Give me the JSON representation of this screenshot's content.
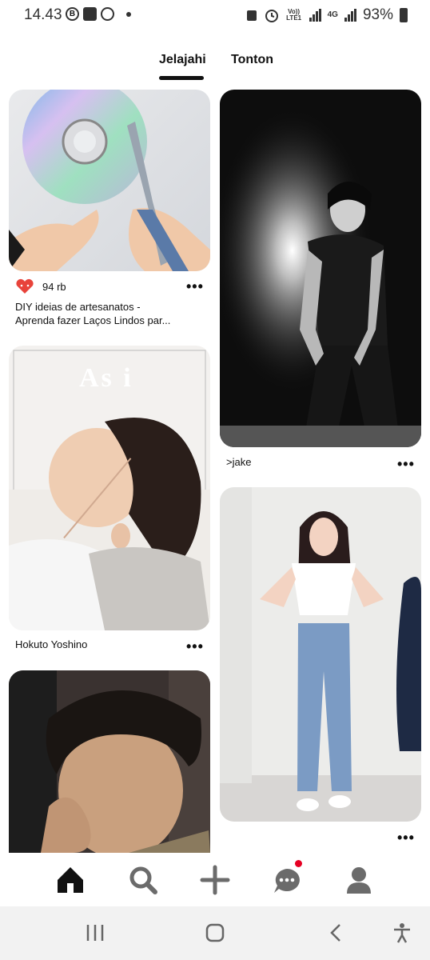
{
  "status_bar": {
    "time": "14.43",
    "network_label": "Vo)) LTE1",
    "network_type": "4G",
    "battery_percent": "93%"
  },
  "tabs": [
    {
      "label": "Jelajahi",
      "active": true
    },
    {
      "label": "Tonton",
      "active": false
    }
  ],
  "pins": {
    "diy": {
      "likes": "94 rb",
      "title_line1": "DIY ideias de artesanatos  -",
      "title_line2": "Aprenda fazer Laços Lindos par..."
    },
    "jake": {
      "title": ">jake"
    },
    "hokuto": {
      "title": "Hokuto Yoshino",
      "image_text": "As i"
    }
  },
  "more_label": "•••",
  "bottom_nav": {
    "items": [
      "home-icon",
      "search-icon",
      "add-icon",
      "messages-icon",
      "profile-icon"
    ],
    "notification_color": "#e60023"
  },
  "system_nav": {
    "items": [
      "recent-apps-icon",
      "home-button-icon",
      "back-icon",
      "accessibility-icon"
    ]
  }
}
